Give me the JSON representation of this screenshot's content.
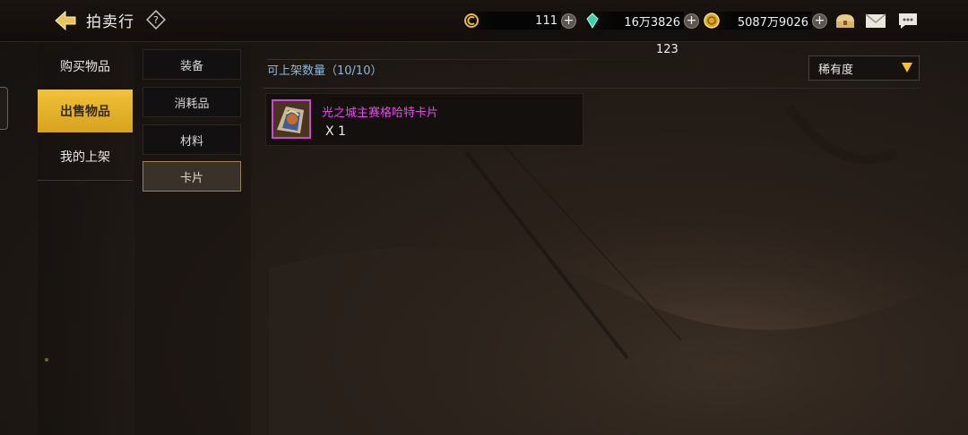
{
  "header": {
    "title": "拍卖行",
    "currencies": [
      {
        "icon": "c-coin-icon",
        "value": "111"
      },
      {
        "icon": "green-gem-icon",
        "value": "16万3826"
      },
      {
        "icon": "gold-coin-icon",
        "value": "5087万9026"
      }
    ],
    "icons": [
      "chest-icon",
      "mail-icon",
      "chat-icon"
    ]
  },
  "left_nav": {
    "items": [
      {
        "label": "购买物品",
        "active": false
      },
      {
        "label": "出售物品",
        "active": true
      },
      {
        "label": "我的上架",
        "active": false
      }
    ]
  },
  "sub_nav": {
    "items": [
      {
        "label": "装备",
        "active": false
      },
      {
        "label": "消耗品",
        "active": false
      },
      {
        "label": "材料",
        "active": false
      },
      {
        "label": "卡片",
        "active": true
      }
    ]
  },
  "main": {
    "listing_count": "可上架数量（10/10）",
    "top_number": "123",
    "sort_dropdown": "稀有度",
    "items": [
      {
        "name": "光之城主赛格哈特卡片",
        "quantity": "X 1",
        "rarity_color": "#e24be8"
      }
    ]
  },
  "colors": {
    "accent": "#f0c23a",
    "rarity_purple": "#e24be8",
    "label_blue": "#8fb6d8"
  }
}
